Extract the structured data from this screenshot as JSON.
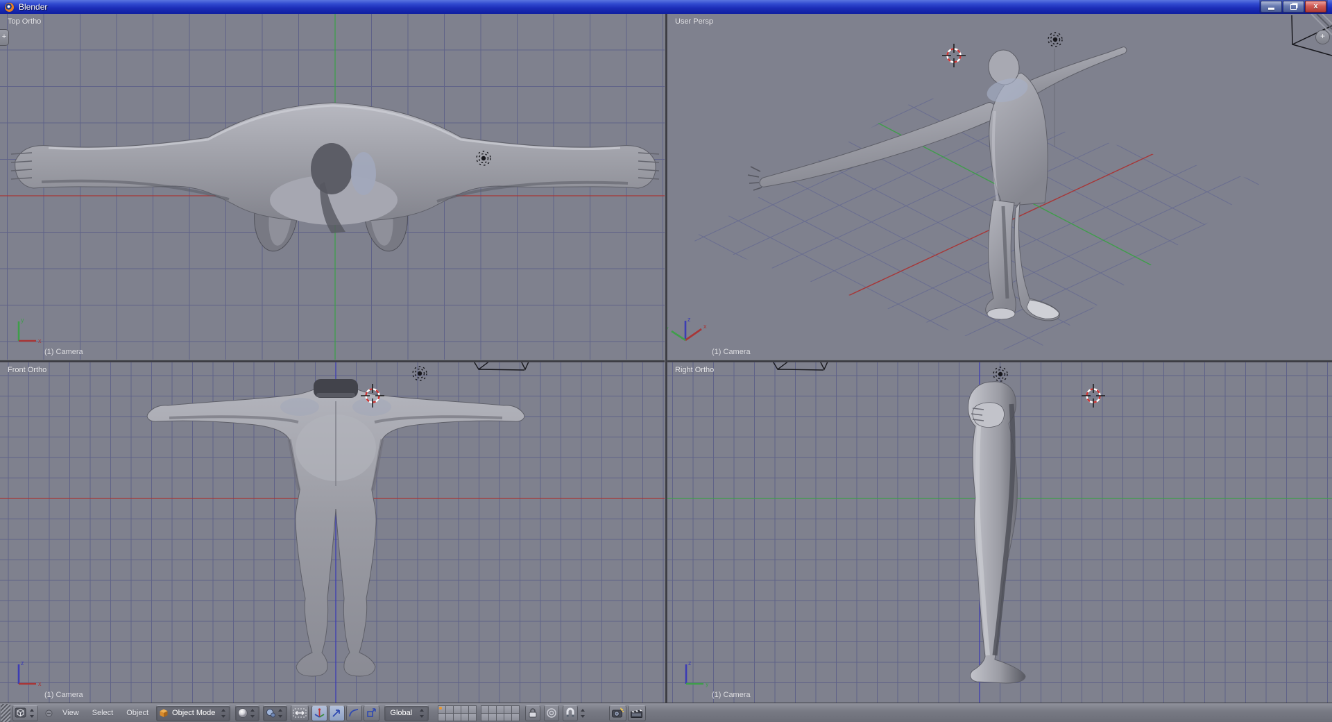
{
  "window": {
    "title": "Blender",
    "controls": [
      "minimize-button",
      "restore-button",
      "close-button"
    ]
  },
  "panel_tabs": {
    "left_plus": "+",
    "right_plus": "+"
  },
  "viewports": [
    {
      "id": "top-ortho",
      "label": "Top Ortho",
      "camera": "(1) Camera",
      "gizmo": {
        "up": "y",
        "right": "x"
      }
    },
    {
      "id": "user-persp",
      "label": "User Persp",
      "camera": "(1) Camera",
      "gizmo": {
        "up": "z",
        "right": "x",
        "depth": "y"
      }
    },
    {
      "id": "front-ortho",
      "label": "Front Ortho",
      "camera": "(1) Camera",
      "gizmo": {
        "up": "z",
        "right": "x"
      }
    },
    {
      "id": "right-ortho",
      "label": "Right Ortho",
      "camera": "(1) Camera",
      "gizmo": {
        "up": "z",
        "right": "y"
      }
    }
  ],
  "overlays": {
    "lamp_icon": "lamp-icon",
    "cursor_icon": "3d-cursor-icon",
    "camera_icon": "camera-wireframe-icon"
  },
  "header": {
    "editor_type_icon": "3d-viewport-editor-icon",
    "collapse_icon": "collapse-menus-icon",
    "menus": [
      "View",
      "Select",
      "Object"
    ],
    "mode": {
      "icon": "object-mode-cube-icon",
      "label": "Object Mode"
    },
    "draw_type": {
      "icon": "solid-shading-sphere-icon"
    },
    "pivot": {
      "icon": "rotation-pivot-icon"
    },
    "manipulator_icons": [
      "manipulator-toggle-icon",
      "translate-manipulator-icon",
      "rotate-manipulator-icon",
      "scale-manipulator-icon"
    ],
    "orientation": {
      "label": "Global"
    },
    "layers": {
      "groups": 2,
      "buttons_per_group": 10,
      "active_layer": 1
    },
    "toggle_icons": [
      "lock-icon",
      "proportional-edit-icon",
      "snap-magnet-icon"
    ],
    "render_icons": [
      "render-camera-icon",
      "render-anim-clapper-icon"
    ]
  },
  "colors": {
    "viewport_bg": "#7f818e",
    "grid_line": "#5f6288",
    "grid_persp": "#666a90",
    "axis_x": "#a83636",
    "axis_y": "#3f9e4a",
    "axis_z": "#3c3cb4",
    "model_light": "#c7c8cf",
    "model_mid": "#9b9ca4",
    "model_dark": "#55565f",
    "active_layer_dot": "#e8962e",
    "mode_cube_orange": "#d98b2c",
    "overlay_black": "#17171c",
    "cursor_red": "#cc3333"
  }
}
